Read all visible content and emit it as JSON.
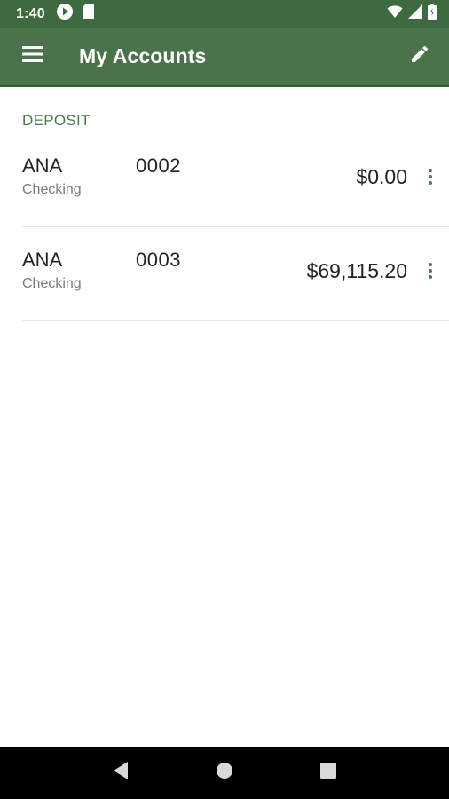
{
  "status_bar": {
    "time": "1:40",
    "icons": [
      "play-circle-icon",
      "sd-card-icon",
      "wifi-icon",
      "signal-icon",
      "battery-icon"
    ]
  },
  "app_bar": {
    "title": "My Accounts",
    "menu_icon": "hamburger-menu-icon",
    "edit_icon": "pencil-edit-icon",
    "color": "#4a734b"
  },
  "deposit_section": {
    "header": "DEPOSIT",
    "accent_color": "#4a7a4b",
    "accounts": [
      {
        "name": "ANA",
        "type": "Checking",
        "number": "0002",
        "balance": "$0.00"
      },
      {
        "name": "ANA",
        "type": "Checking",
        "number": "0003",
        "balance": "$69,115.20"
      }
    ]
  },
  "nav_bar": {
    "buttons": [
      "back-triangle-icon",
      "home-circle-icon",
      "recents-square-icon"
    ]
  }
}
